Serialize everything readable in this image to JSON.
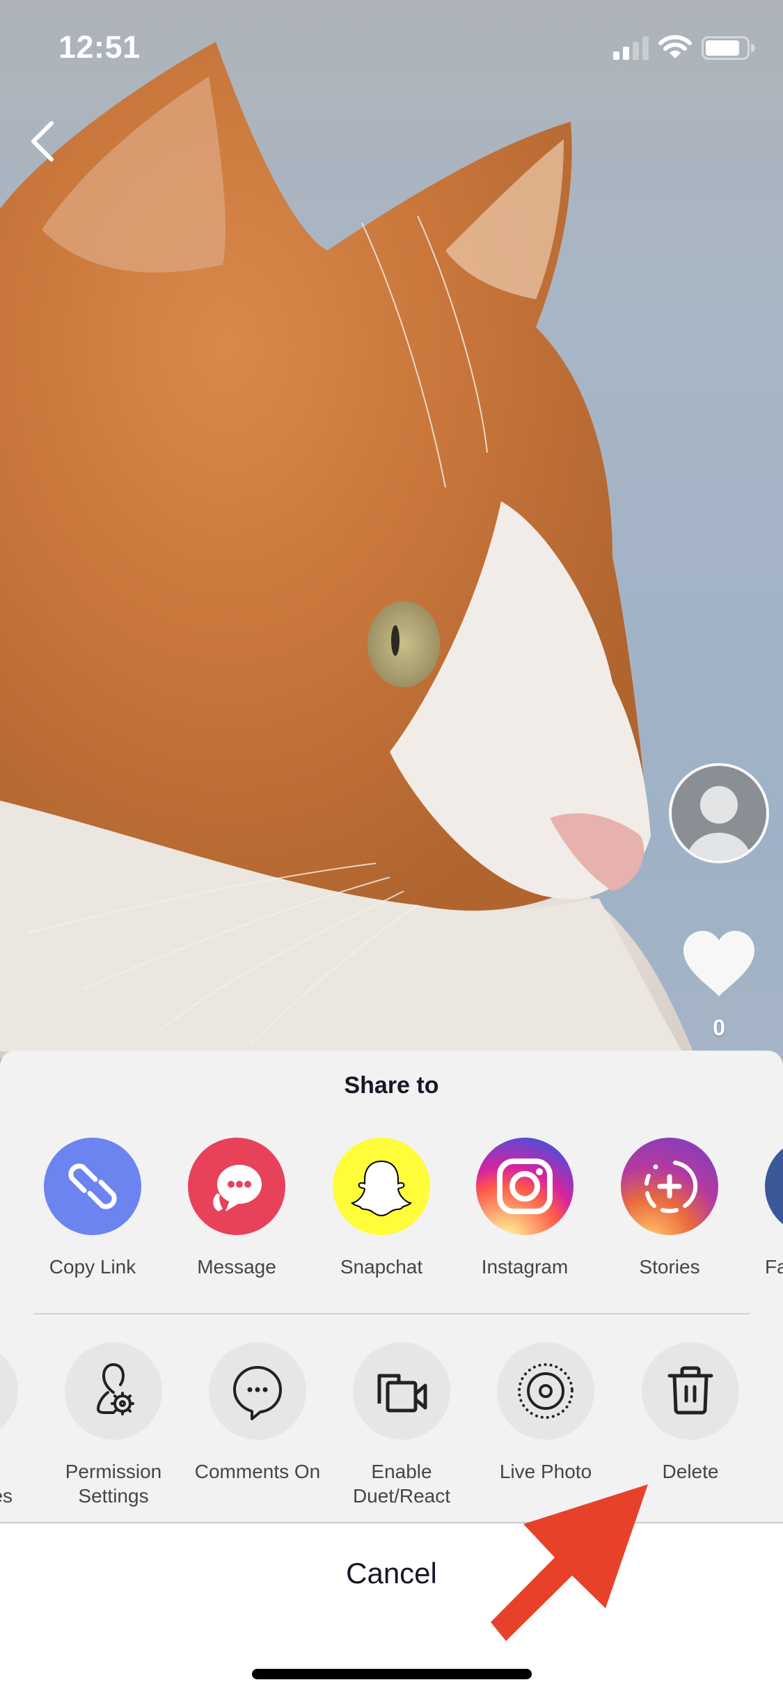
{
  "status_bar": {
    "time": "12:51",
    "signal_bars_filled": 2,
    "signal_bars_total": 4,
    "battery_level": 0.85,
    "icons": [
      "signal-icon",
      "wifi-icon",
      "battery-icon"
    ]
  },
  "navigation": {
    "back_icon": "chevron-left-icon"
  },
  "video": {
    "subject": "orange and white cat in profile",
    "avatar_icon": "user-placeholder-icon",
    "like_icon": "heart-icon",
    "like_count": "0"
  },
  "share_sheet": {
    "title": "Share to",
    "share_targets": [
      {
        "label": "Copy Link",
        "icon": "link-icon",
        "color": "#6B84F0"
      },
      {
        "label": "Message",
        "icon": "message-bubble-icon",
        "color": "#E8415A"
      },
      {
        "label": "Snapchat",
        "icon": "snapchat-ghost-icon",
        "color": "#FFFC3A"
      },
      {
        "label": "Instagram",
        "icon": "instagram-icon",
        "color": "#C13584"
      },
      {
        "label": "Stories",
        "icon": "stories-add-icon",
        "color": "#A33FA0"
      },
      {
        "label": "Fa",
        "icon": "facebook-icon",
        "color": "#3B5998"
      }
    ],
    "actions": [
      {
        "label": "es",
        "icon": "partial-action-icon"
      },
      {
        "label": "Permission Settings",
        "line1": "Permission",
        "line2": "Settings",
        "icon": "user-settings-icon"
      },
      {
        "label": "Comments On",
        "line1": "Comments On",
        "line2": "",
        "icon": "comment-icon"
      },
      {
        "label": "Enable Duet/React",
        "line1": "Enable",
        "line2": "Duet/React",
        "icon": "duet-camera-icon"
      },
      {
        "label": "Live Photo",
        "line1": "Live Photo",
        "line2": "",
        "icon": "live-photo-icon"
      },
      {
        "label": "Delete",
        "line1": "Delete",
        "line2": "",
        "icon": "trash-icon"
      }
    ],
    "cancel_label": "Cancel"
  },
  "annotation": {
    "type": "arrow",
    "color": "#E8412A",
    "points_to": "Delete"
  }
}
